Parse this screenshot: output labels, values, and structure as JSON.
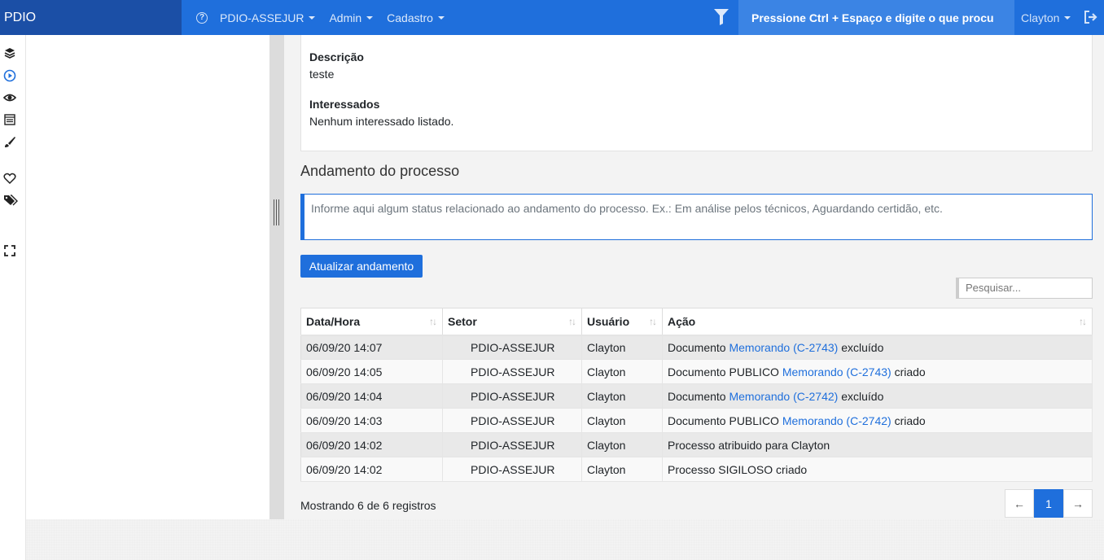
{
  "navbar": {
    "brand": "PDIO",
    "menus": [
      {
        "label": "PDIO-ASSEJUR"
      },
      {
        "label": "Admin"
      },
      {
        "label": "Cadastro"
      }
    ],
    "search_text": "Pressione Ctrl + Espaço e digite o que procu",
    "user": "Clayton"
  },
  "details": {
    "descricao_label": "Descrição",
    "descricao_value": "teste",
    "interessados_label": "Interessados",
    "interessados_value": "Nenhum interessado listado."
  },
  "andamento": {
    "title": "Andamento do processo",
    "placeholder": "Informe aqui algum status relacionado ao andamento do processo. Ex.: Em análise pelos técnicos, Aguardando certidão, etc.",
    "button_label": "Atualizar andamento",
    "search_placeholder": "Pesquisar..."
  },
  "table": {
    "headers": [
      "Data/Hora",
      "Setor",
      "Usuário",
      "Ação"
    ],
    "rows": [
      {
        "datetime": "06/09/20 14:07",
        "setor": "PDIO-ASSEJUR",
        "usuario": "Clayton",
        "acao_pre": "Documento ",
        "acao_link": "Memorando (C-2743)",
        "acao_post": " excluído"
      },
      {
        "datetime": "06/09/20 14:05",
        "setor": "PDIO-ASSEJUR",
        "usuario": "Clayton",
        "acao_pre": "Documento PUBLICO ",
        "acao_link": "Memorando (C-2743)",
        "acao_post": " criado"
      },
      {
        "datetime": "06/09/20 14:04",
        "setor": "PDIO-ASSEJUR",
        "usuario": "Clayton",
        "acao_pre": "Documento ",
        "acao_link": "Memorando (C-2742)",
        "acao_post": " excluído"
      },
      {
        "datetime": "06/09/20 14:03",
        "setor": "PDIO-ASSEJUR",
        "usuario": "Clayton",
        "acao_pre": "Documento PUBLICO ",
        "acao_link": "Memorando (C-2742)",
        "acao_post": " criado"
      },
      {
        "datetime": "06/09/20 14:02",
        "setor": "PDIO-ASSEJUR",
        "usuario": "Clayton",
        "acao_pre": "Processo atribuido para Clayton",
        "acao_link": "",
        "acao_post": ""
      },
      {
        "datetime": "06/09/20 14:02",
        "setor": "PDIO-ASSEJUR",
        "usuario": "Clayton",
        "acao_pre": "Processo SIGILOSO criado",
        "acao_link": "",
        "acao_post": ""
      }
    ],
    "info": "Mostrando 6 de 6 registros",
    "pagination": {
      "prev": "←",
      "current": "1",
      "next": "→"
    }
  },
  "colors": {
    "primary": "#1f6fdc",
    "brand_bg": "#1b4fa6"
  },
  "icons": [
    "help-icon",
    "filter-icon",
    "logout-icon",
    "layers-icon",
    "play-circle-icon",
    "eye-icon",
    "calendar-icon",
    "brush-icon",
    "heart-icon",
    "tags-icon",
    "expand-icon"
  ]
}
